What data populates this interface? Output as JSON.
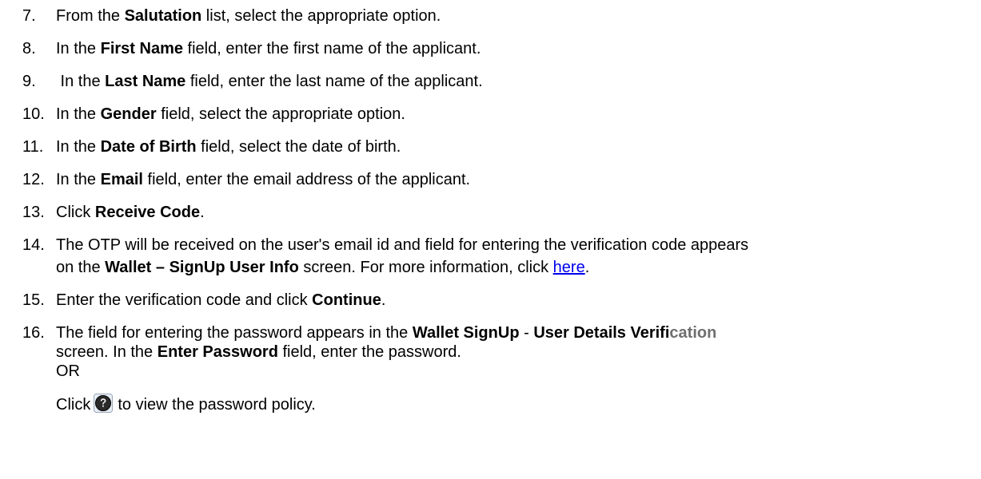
{
  "steps": [
    {
      "num": "7.",
      "pre": "From the ",
      "b1": "Salutation",
      "post": " list, select the appropriate option."
    },
    {
      "num": "8.",
      "pre": "In the ",
      "b1": "First Name",
      "post": " field, enter the first name of the applicant."
    },
    {
      "num": "9.",
      "pre": " In the ",
      "b1": "Last Name",
      "post": " field, enter the last name of the applicant."
    },
    {
      "num": "10.",
      "pre": "In the ",
      "b1": "Gender",
      "post": " field, select the appropriate option."
    },
    {
      "num": "11.",
      "pre": "In the ",
      "b1": "Date of Birth",
      "post": " field, select the date of birth."
    },
    {
      "num": "12.",
      "pre": "In the ",
      "b1": "Email",
      "post": " field, enter the email address of the applicant."
    },
    {
      "num": "13.",
      "pre": "Click ",
      "b1": "Receive Code",
      "post": "."
    },
    {
      "num": "14.",
      "line1": "The OTP will be received on the user's email id and field for entering the verification code appears",
      "l2_pre": "on the ",
      "l2_b": "Wallet – SignUp User Info",
      "l2_mid": " screen. For more information, click ",
      "l2_link": "here",
      "l2_post": "."
    },
    {
      "num": "15.",
      "pre": "Enter the verification code and click ",
      "b1": "Continue",
      "post": "."
    },
    {
      "num": "16.",
      "l1_pre": "The field for entering the password appears in the ",
      "l1_b1": "Wallet SignUp",
      "l1_mid": " - ",
      "l1_b2": "User Details Verifi",
      "l1_b2_faded": "cation",
      "l2_pre": "screen. In the ",
      "l2_b": "Enter Password",
      "l2_post": " field, enter the password.",
      "l3": "OR",
      "l4_pre": "Click",
      "l4_post": "to view the password policy."
    }
  ],
  "icons": {
    "help": "help-question-icon",
    "help_color": "#2a2a2a"
  }
}
